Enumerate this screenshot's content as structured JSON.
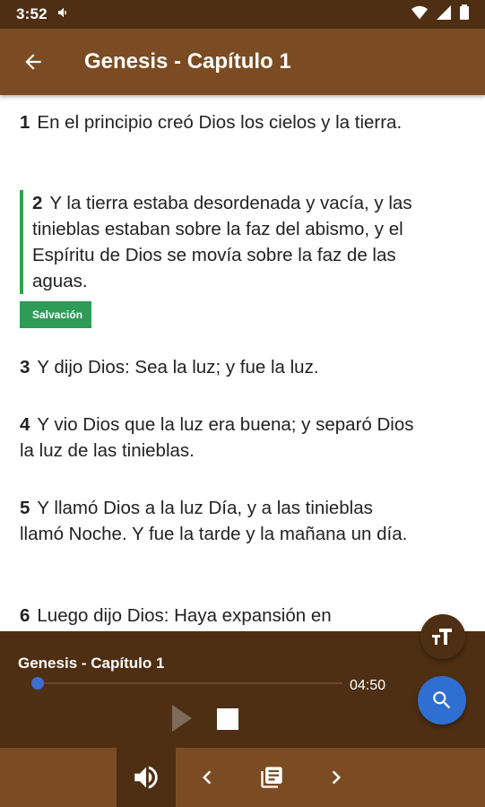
{
  "status_bar": {
    "time": "3:52"
  },
  "app_bar": {
    "title": "Genesis - Capítulo 1"
  },
  "verses": [
    {
      "num": "1",
      "text": "En el principio creó Dios los cielos y la tierra."
    },
    {
      "num": "2",
      "text": "Y la tierra estaba desordenada y vacía, y las tinieblas estaban sobre la faz del abismo, y el Espíritu de Dios se movía sobre la faz de las aguas.",
      "tag": "Salvación"
    },
    {
      "num": "3",
      "text": "Y dijo Dios: Sea la luz; y fue la luz."
    },
    {
      "num": "4",
      "text": "Y vio Dios que la luz era buena; y separó Dios la luz de las tinieblas."
    },
    {
      "num": "5",
      "text": "Y llamó Dios a la luz Día, y a las tinieblas llamó Noche. Y fue la tarde y la mañana un día."
    },
    {
      "num": "6",
      "text": "Luego dijo Dios: Haya expansión en"
    }
  ],
  "player": {
    "title": "Genesis - Capítulo 1",
    "duration": "04:50",
    "progress": 0.0
  },
  "colors": {
    "app_bar": "#7b4c23",
    "dark_brown": "#4e2f13",
    "tag_green": "#2e9b57",
    "accent_blue": "#2f6fd1"
  },
  "icons": {
    "back": "arrow-left-icon",
    "text_size": "text-size-icon",
    "search": "search-icon",
    "play": "play-icon",
    "stop": "stop-icon",
    "audio": "volume-icon",
    "prev": "chevron-left-icon",
    "book": "book-icon",
    "next": "chevron-right-icon"
  }
}
